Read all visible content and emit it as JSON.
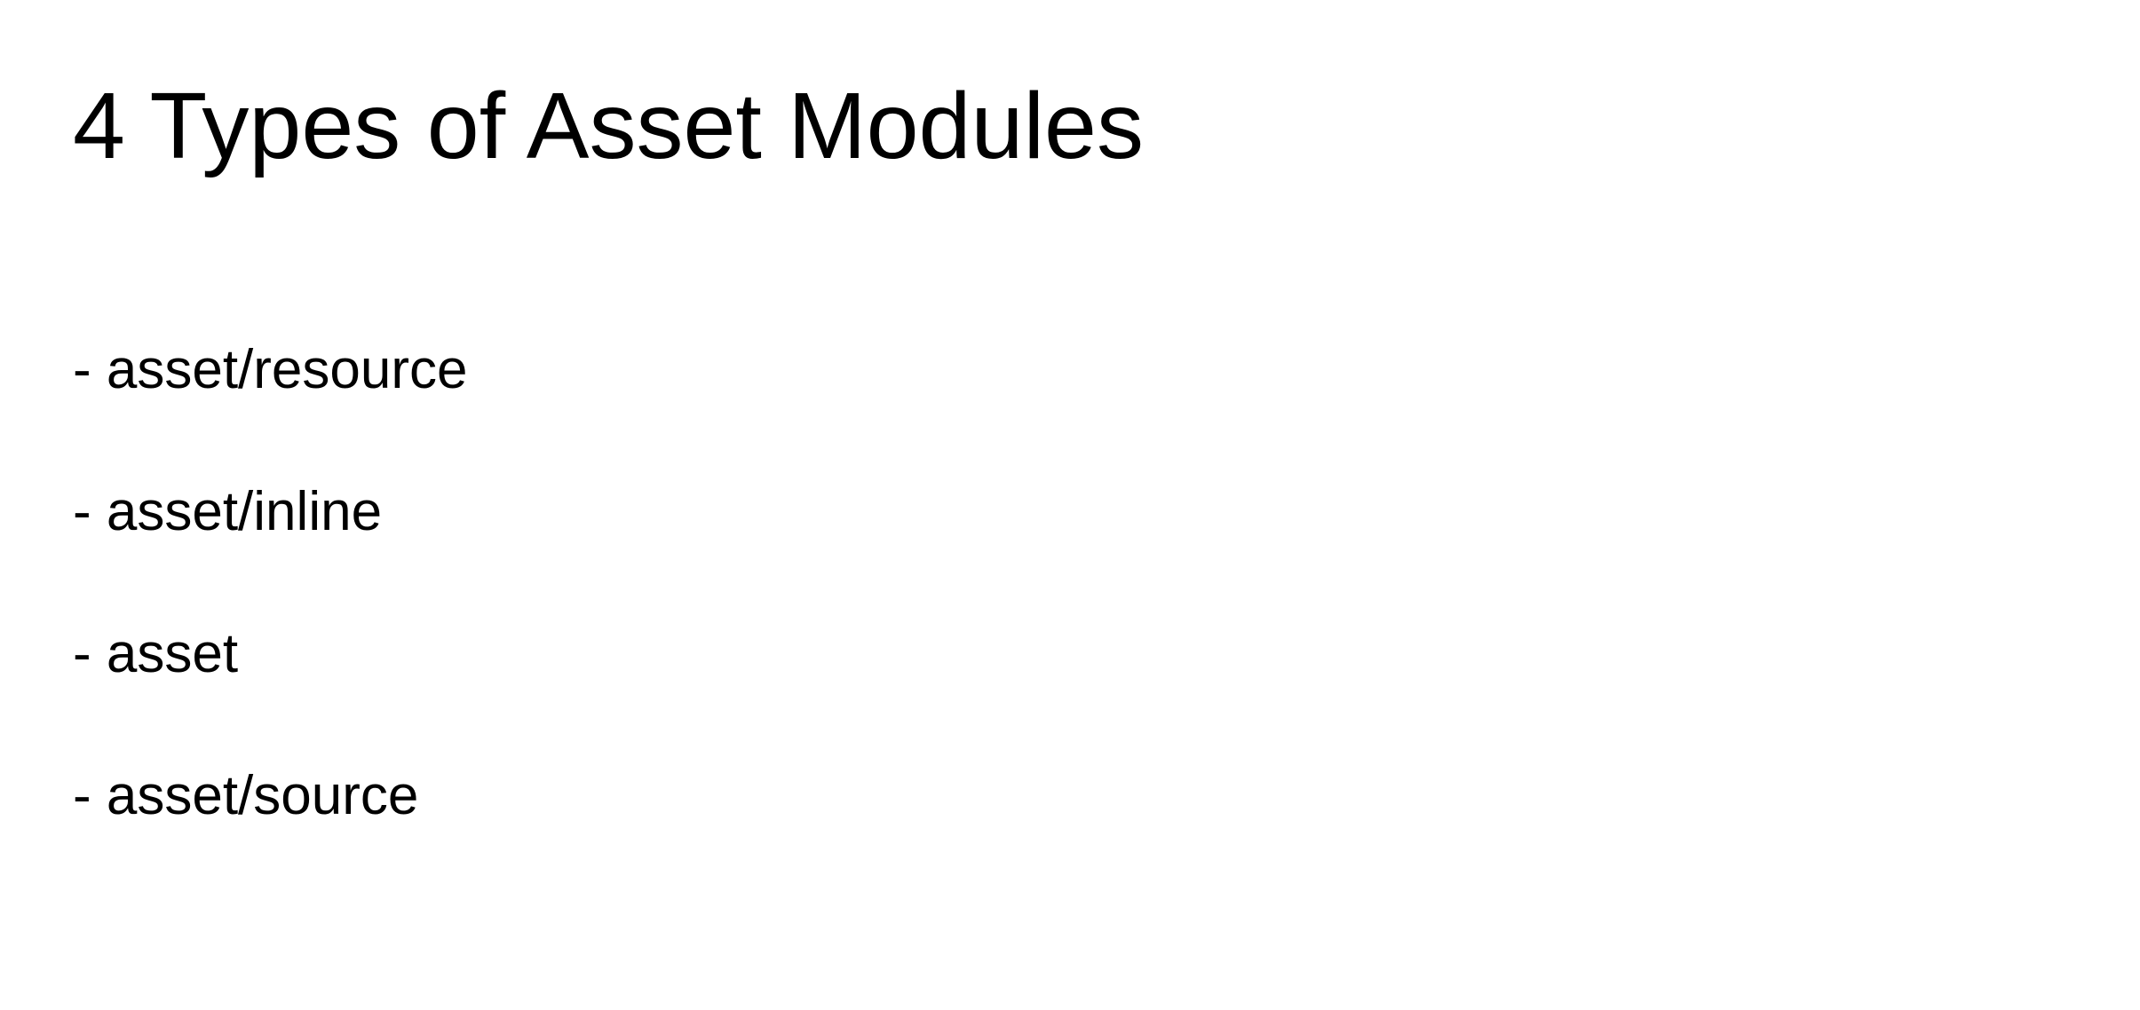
{
  "slide": {
    "title": "4 Types of Asset Modules",
    "items": [
      {
        "text": "- asset/resource"
      },
      {
        "text": "- asset/inline"
      },
      {
        "text": "- asset"
      },
      {
        "text": "- asset/source"
      }
    ]
  }
}
